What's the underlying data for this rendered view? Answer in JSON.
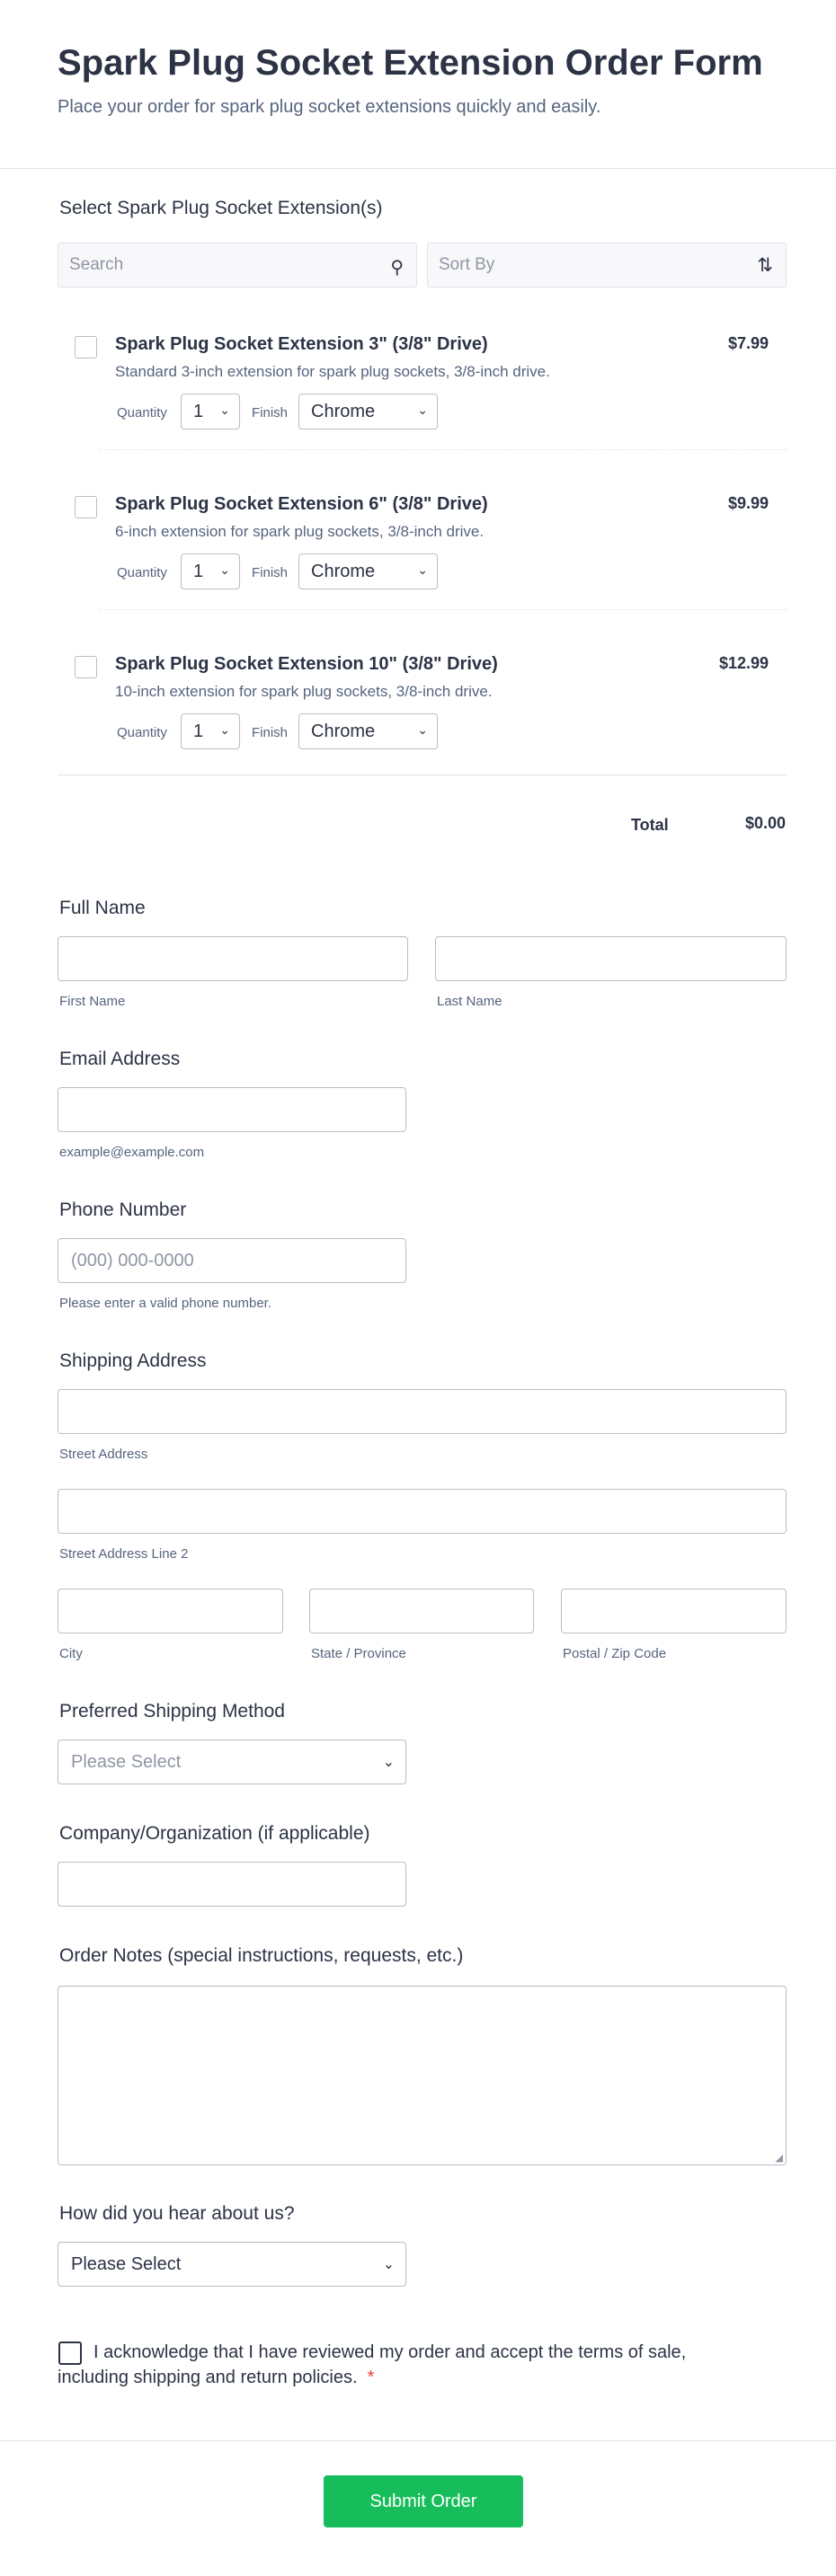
{
  "header": {
    "title": "Spark Plug Socket Extension Order Form",
    "subtitle": "Place your order for spark plug socket extensions quickly and easily."
  },
  "products_section": {
    "label": "Select Spark Plug Socket Extension(s)",
    "search_placeholder": "Search",
    "sort_placeholder": "Sort By",
    "items": [
      {
        "name": "Spark Plug Socket Extension 3\" (3/8\" Drive)",
        "description": "Standard 3-inch extension for spark plug sockets, 3/8-inch drive.",
        "price": "$7.99",
        "quantity_label": "Quantity",
        "quantity": "1",
        "finish_label": "Finish",
        "finish": "Chrome"
      },
      {
        "name": "Spark Plug Socket Extension 6\" (3/8\" Drive)",
        "description": "6-inch extension for spark plug sockets, 3/8-inch drive.",
        "price": "$9.99",
        "quantity_label": "Quantity",
        "quantity": "1",
        "finish_label": "Finish",
        "finish": "Chrome"
      },
      {
        "name": "Spark Plug Socket Extension 10\" (3/8\" Drive)",
        "description": "10-inch extension for spark plug sockets, 3/8-inch drive.",
        "price": "$12.99",
        "quantity_label": "Quantity",
        "quantity": "1",
        "finish_label": "Finish",
        "finish": "Chrome"
      }
    ],
    "total_label": "Total",
    "total_value": "$0.00"
  },
  "full_name": {
    "label": "Full Name",
    "first_sub": "First Name",
    "last_sub": "Last Name"
  },
  "email": {
    "label": "Email Address",
    "sub": "example@example.com"
  },
  "phone": {
    "label": "Phone Number",
    "placeholder": "(000) 000-0000",
    "sub": "Please enter a valid phone number."
  },
  "address": {
    "label": "Shipping Address",
    "street_sub": "Street Address",
    "street2_sub": "Street Address Line 2",
    "city_sub": "City",
    "state_sub": "State / Province",
    "zip_sub": "Postal / Zip Code"
  },
  "shipping_method": {
    "label": "Preferred Shipping Method",
    "placeholder": "Please Select"
  },
  "company": {
    "label": "Company/Organization (if applicable)"
  },
  "notes": {
    "label": "Order Notes (special instructions, requests, etc.)"
  },
  "referral": {
    "label": "How did you hear about us?",
    "value": "Please Select"
  },
  "acknowledge": {
    "text": "I acknowledge that I have reviewed my order and accept the terms of sale, including shipping and return policies.",
    "required_mark": "*"
  },
  "submit_label": "Submit Order",
  "colors": {
    "accent": "#18bd5b",
    "text": "#2c3345",
    "muted": "#57647e",
    "required": "#f23a3c"
  }
}
